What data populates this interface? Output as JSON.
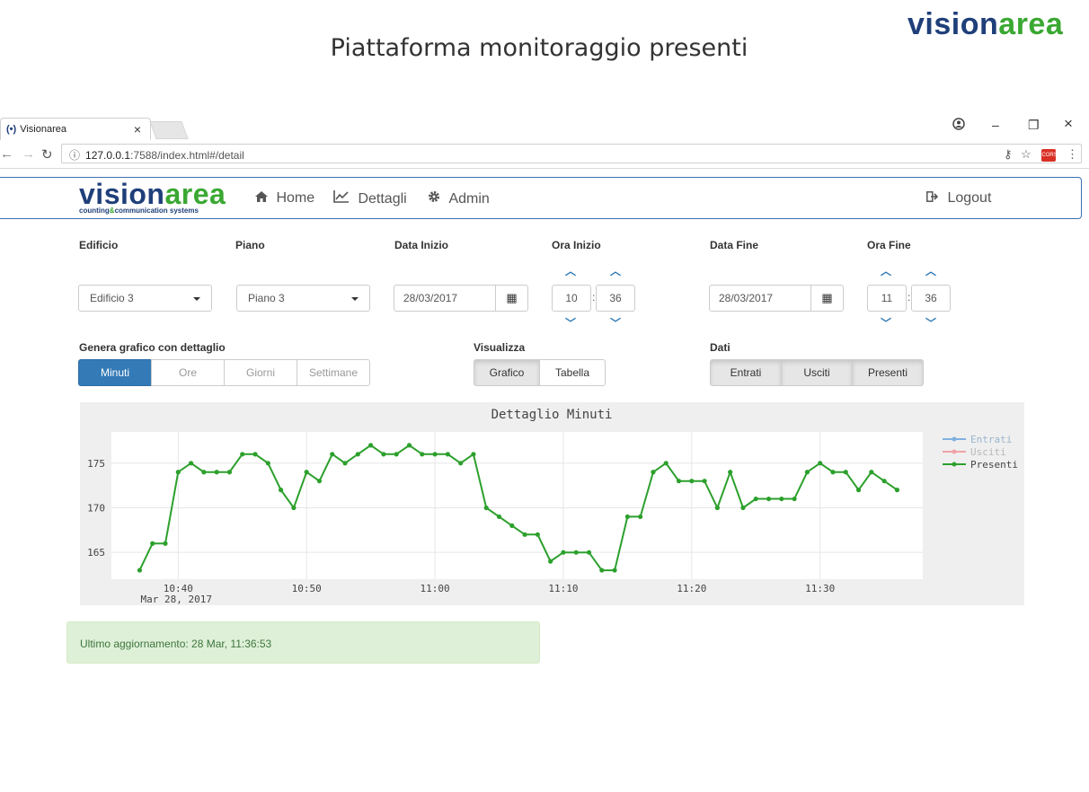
{
  "slide": {
    "brand_part1": "visi",
    "brand_o": "o",
    "brand_part2": "n",
    "brand_part3": "area",
    "title": "Piattaforma monitoraggio presenti"
  },
  "browser": {
    "tab_title": "Visionarea",
    "tab_close": "×",
    "url_host": "127.0.0.1",
    "url_rest": ":7588/index.html#/detail",
    "back_icon": "arrow-left",
    "forward_icon": "arrow-right",
    "reload_icon": "reload",
    "window_min": "–",
    "window_restore": "❐",
    "window_close": "×",
    "profile_icon": "account-circle"
  },
  "app": {
    "logo_main_1": "visi",
    "logo_main_2": "area",
    "logo_o": "o",
    "logo_n": "n",
    "logo_sub_1": "counting",
    "logo_sub_amp": "&",
    "logo_sub_2": "communication systems",
    "nav": {
      "home": "Home",
      "dettagli": "Dettagli",
      "admin": "Admin",
      "logout": "Logout"
    }
  },
  "form": {
    "edificio_label": "Edificio",
    "edificio_value": "Edificio 3",
    "piano_label": "Piano",
    "piano_value": "Piano 3",
    "data_inizio_label": "Data Inizio",
    "data_inizio_value": "28/03/2017",
    "ora_inizio_label": "Ora Inizio",
    "ora_inizio_h": "10",
    "ora_inizio_m": "36",
    "data_fine_label": "Data Fine",
    "data_fine_value": "28/03/2017",
    "ora_fine_label": "Ora Fine",
    "ora_fine_h": "11",
    "ora_fine_m": "36",
    "colon": ":",
    "genera_label": "Genera grafico con dettaglio",
    "detail_buttons": [
      "Minuti",
      "Ore",
      "Giorni",
      "Settimane"
    ],
    "visualizza_label": "Visualizza",
    "visualizza_buttons": [
      "Grafico",
      "Tabella"
    ],
    "dati_label": "Dati",
    "dati_buttons": [
      "Entrati",
      "Usciti",
      "Presenti"
    ]
  },
  "chart_data": {
    "type": "line",
    "title": "Dettaglio Minuti",
    "xlabel": "",
    "ylabel": "",
    "x_start": "10:37",
    "x_ticks": [
      "10:40",
      "10:50",
      "11:00",
      "11:10",
      "11:20",
      "11:30"
    ],
    "x_tick_date": "Mar 28, 2017",
    "y_ticks": [
      165,
      170,
      175
    ],
    "ylim": [
      162,
      178.5
    ],
    "grid": true,
    "legend_position": "right",
    "colors": {
      "entrati": "#7fb1e0",
      "usciti": "#f1a2a9",
      "presenti": "#2ca02c"
    },
    "series": [
      {
        "name": "Entrati",
        "values": []
      },
      {
        "name": "Usciti",
        "values": []
      },
      {
        "name": "Presenti",
        "values": [
          163,
          166,
          166,
          174,
          175,
          174,
          174,
          174,
          176,
          176,
          175,
          172,
          170,
          174,
          173,
          176,
          175,
          176,
          177,
          176,
          176,
          177,
          176,
          176,
          176,
          175,
          176,
          170,
          169,
          168,
          167,
          167,
          164,
          165,
          165,
          165,
          163,
          163,
          169,
          169,
          174,
          175,
          173,
          173,
          173,
          170,
          174,
          170,
          171,
          171,
          171,
          171,
          174,
          175,
          174,
          174,
          172,
          174,
          173,
          172
        ]
      }
    ]
  },
  "status": {
    "text": "Ultimo aggiornamento: 28 Mar, 11:36:53"
  }
}
